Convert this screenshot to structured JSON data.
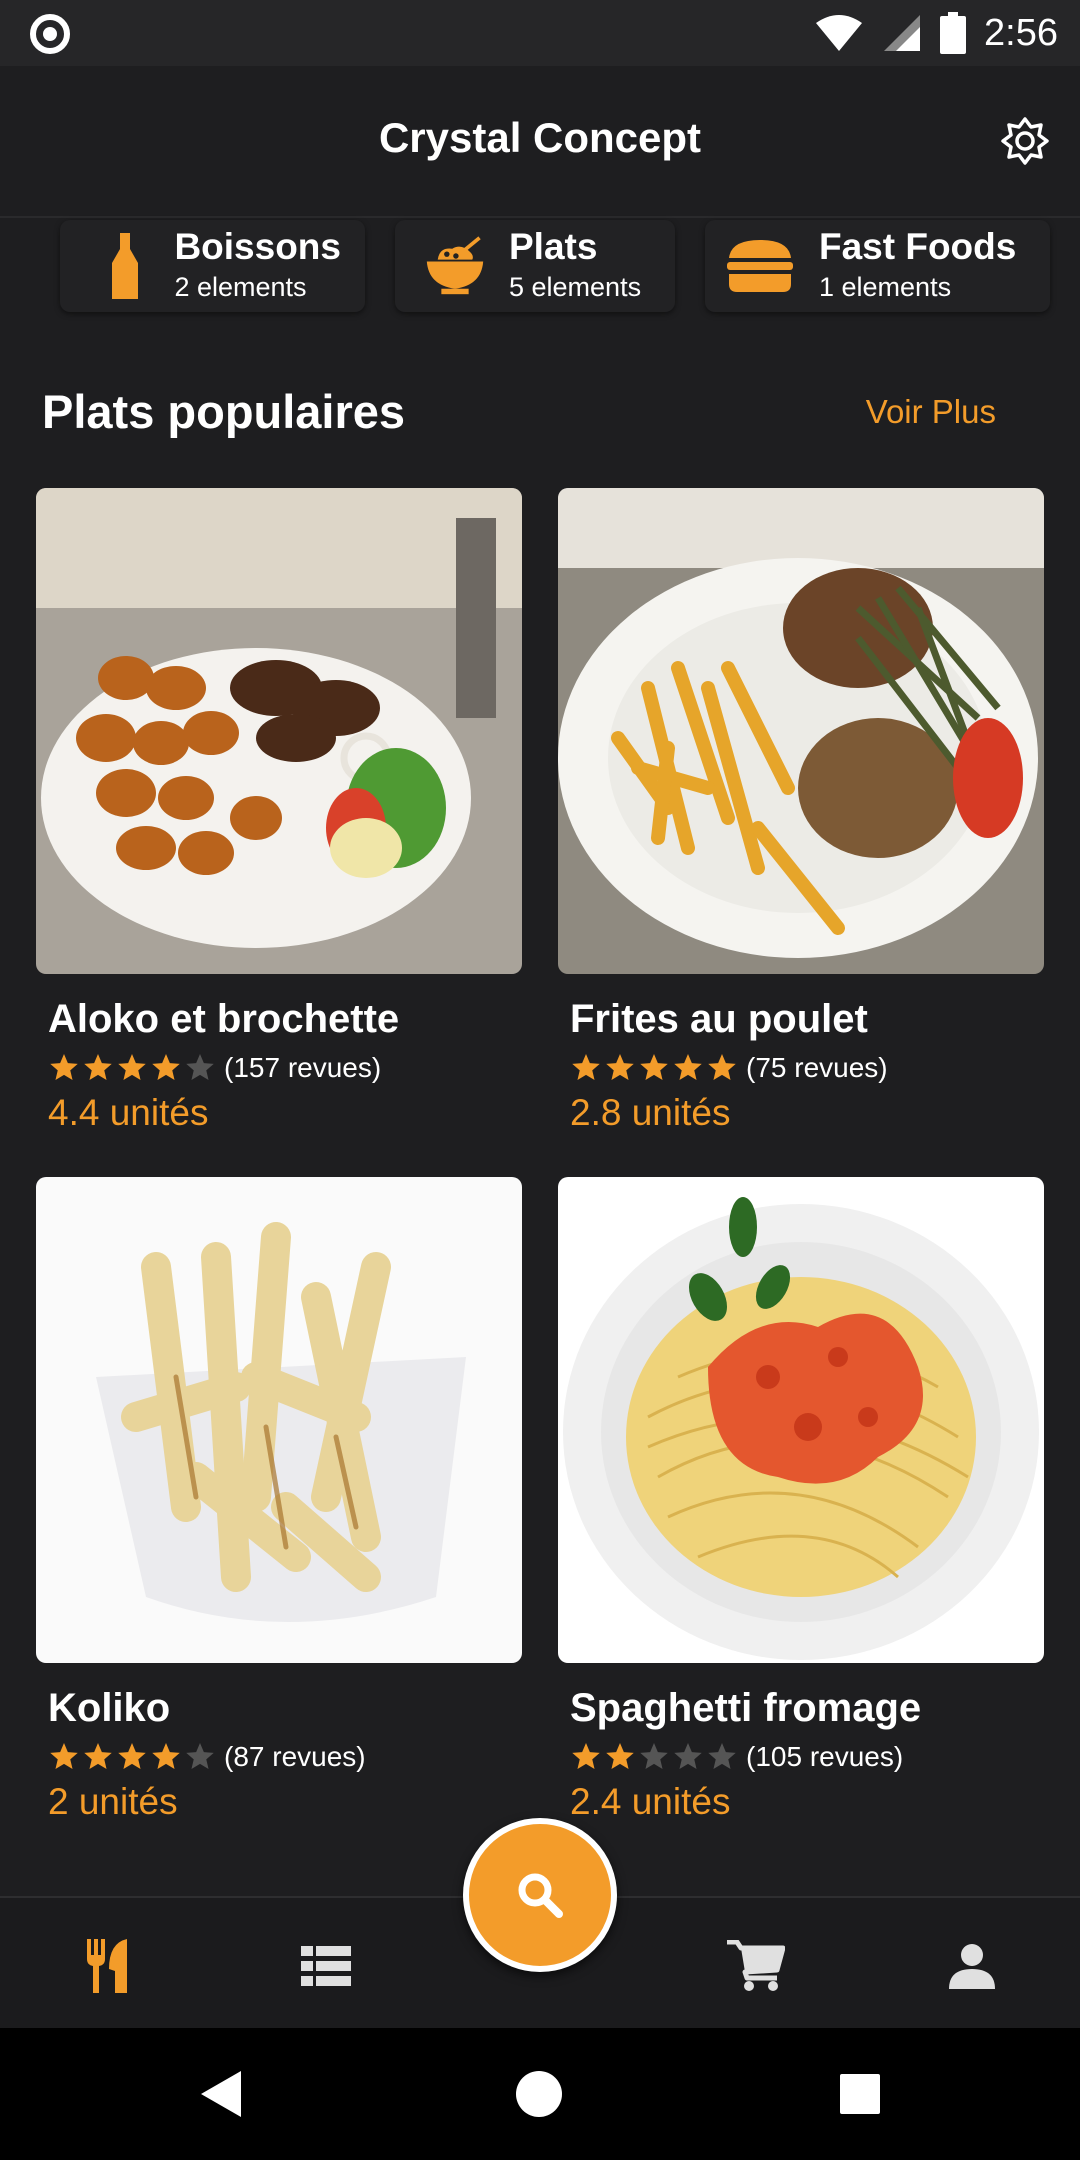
{
  "status_bar": {
    "time": "2:56"
  },
  "app_bar": {
    "title": "Crystal Concept",
    "action_icon": "brightness-icon"
  },
  "categories": [
    {
      "name": "Boissons",
      "count": "2 elements",
      "icon": "bottle-icon"
    },
    {
      "name": "Plats",
      "count": "5 elements",
      "icon": "bowl-icon"
    },
    {
      "name": "Fast Foods",
      "count": "1 elements",
      "icon": "burger-icon"
    }
  ],
  "section": {
    "title": "Plats populaires",
    "more_label": "Voir Plus"
  },
  "products": [
    {
      "name": "Aloko et brochette",
      "rating": 4,
      "reviews": "(157 revues)",
      "price": "4.4 unités"
    },
    {
      "name": "Frites au poulet",
      "rating": 5,
      "reviews": "(75 revues)",
      "price": "2.8 unités"
    },
    {
      "name": "Koliko",
      "rating": 4,
      "reviews": "(87 revues)",
      "price": "2 unités"
    },
    {
      "name": "Spaghetti fromage",
      "rating": 2,
      "reviews": "(105 revues)",
      "price": "2.4 unités"
    }
  ],
  "bottom_nav": [
    "utensils-icon",
    "list-icon",
    "search-icon",
    "cart-icon",
    "user-icon"
  ],
  "colors": {
    "accent": "#f39c2a",
    "background": "#1e1e20",
    "star_empty": "#555555"
  }
}
